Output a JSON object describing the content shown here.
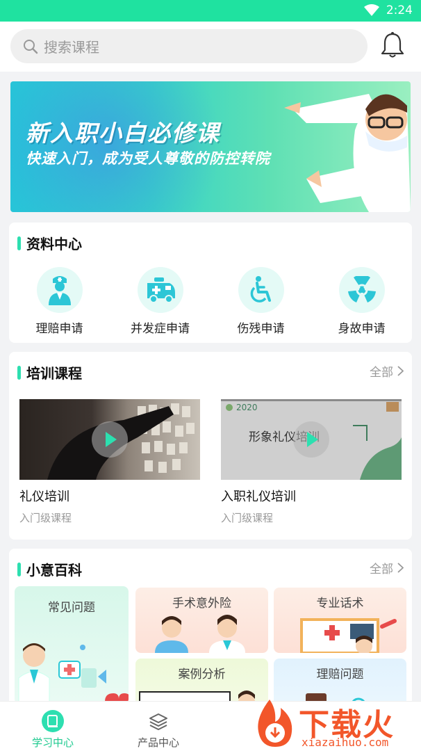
{
  "status_bar": {
    "time": "2:24"
  },
  "search": {
    "placeholder": "搜索课程"
  },
  "banner": {
    "title": "新入职小白必修课",
    "subtitle": "快速入门，成为受人尊敬的防控转院"
  },
  "resources": {
    "title": "资料中心",
    "items": [
      {
        "label": "理赔申请",
        "icon": "nurse-icon"
      },
      {
        "label": "并发症申请",
        "icon": "ambulance-icon"
      },
      {
        "label": "伤残申请",
        "icon": "wheelchair-icon"
      },
      {
        "label": "身故申请",
        "icon": "radiation-icon"
      }
    ]
  },
  "training": {
    "title": "培训课程",
    "more": "全部",
    "courses": [
      {
        "title": "礼仪培训",
        "level": "入门级课程"
      },
      {
        "title": "入职礼仪培训",
        "level": "入门级课程",
        "thumb_caption": "形象礼仪培训",
        "thumb_year": "2020"
      }
    ]
  },
  "wiki": {
    "title": "小意百科",
    "more": "全部",
    "tiles": [
      "常见问题",
      "手术意外险",
      "专业话术",
      "案例分析",
      "理赔问题"
    ]
  },
  "tabs": [
    {
      "label": "学习中心",
      "active": true
    },
    {
      "label": "产品中心",
      "active": false
    }
  ],
  "watermark": {
    "brand": "下载火",
    "url": "xiazaihuo.com"
  },
  "colors": {
    "accent": "#1fe2a0",
    "accent_text": "#1bc98e"
  }
}
